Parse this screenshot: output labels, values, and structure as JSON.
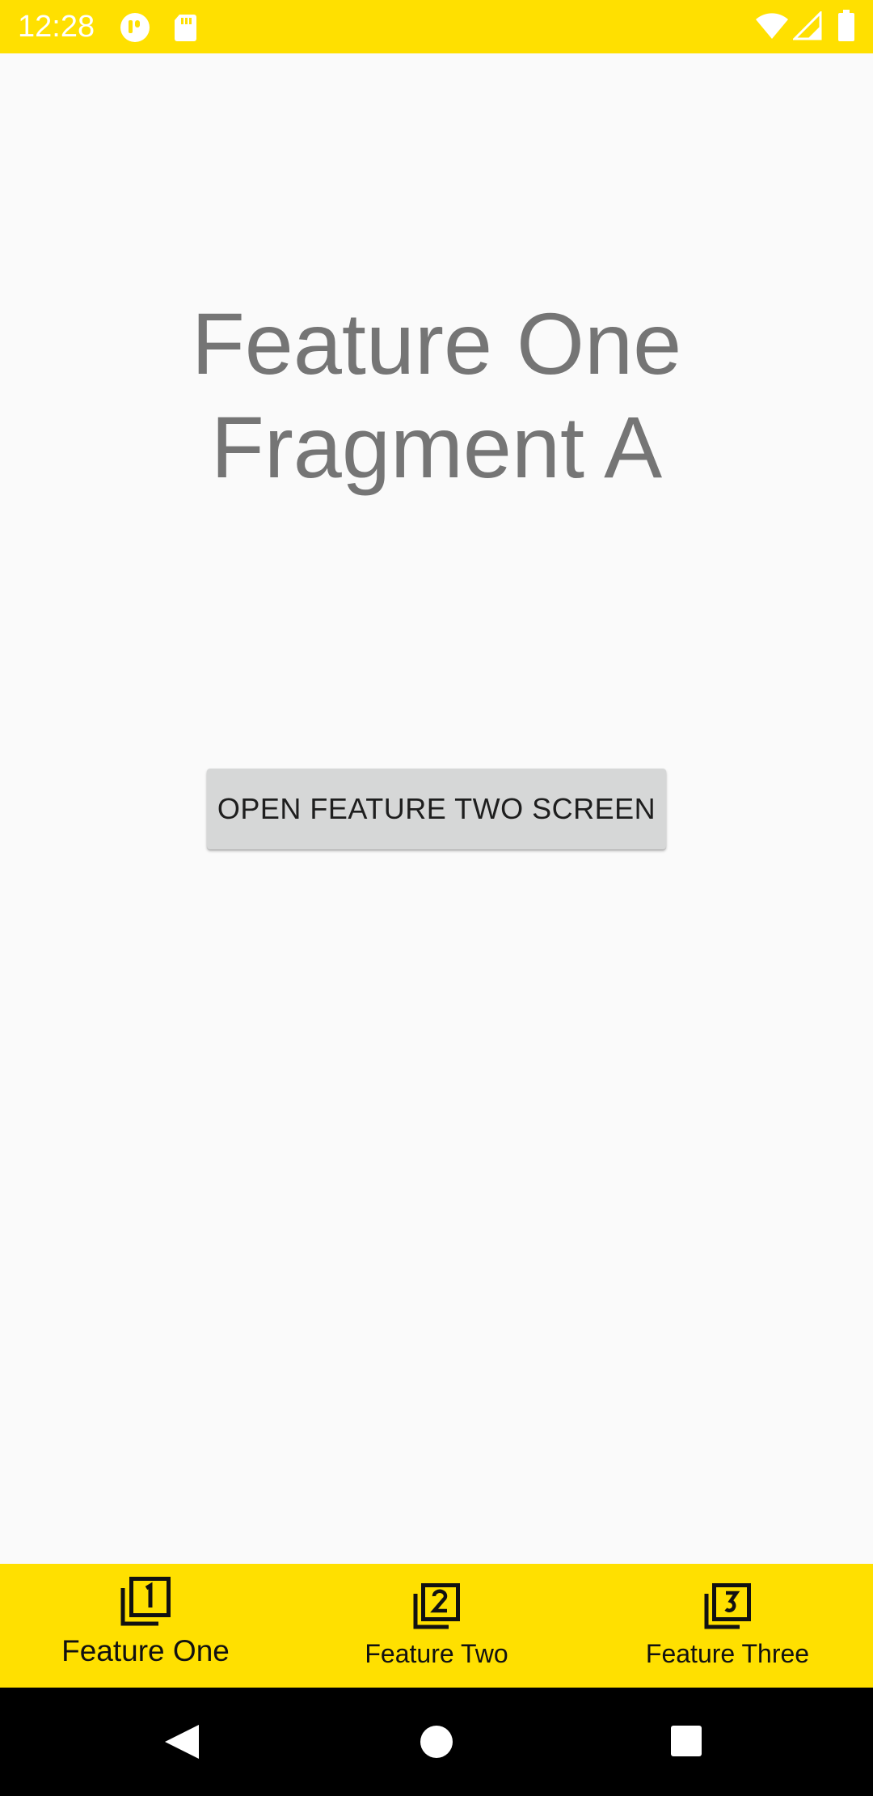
{
  "status_bar": {
    "time": "12:28",
    "background": "#FFE000",
    "icons": [
      "notification-app-icon",
      "sd-card-icon",
      "wifi-icon",
      "signal-icon",
      "battery-icon"
    ]
  },
  "main": {
    "title_line1": "Feature One",
    "title_line2": "Fragment A",
    "button_label": "OPEN FEATURE TWO SCREEN"
  },
  "bottom_nav": {
    "background": "#FFE000",
    "items": [
      {
        "label": "Feature One",
        "icon": "filter-1-icon",
        "active": true
      },
      {
        "label": "Feature Two",
        "icon": "filter-2-icon",
        "active": false
      },
      {
        "label": "Feature Three",
        "icon": "filter-3-icon",
        "active": false
      }
    ]
  },
  "system_nav": {
    "buttons": [
      "back-icon",
      "home-icon",
      "recents-icon"
    ]
  }
}
